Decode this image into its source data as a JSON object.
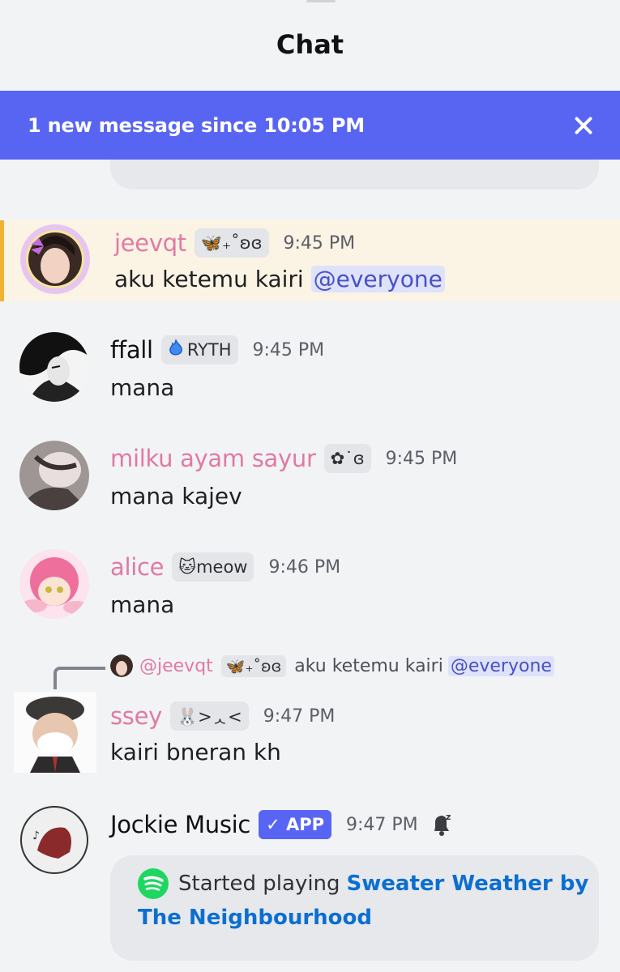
{
  "header": {
    "title": "Chat"
  },
  "banner": {
    "text": "1 new message since 10:05 PM"
  },
  "colors": {
    "accent": "#5865f2",
    "highlight_bar": "#f0b232",
    "highlight_bg": "#fbf3e4",
    "username_pink": "#e07aa4",
    "link": "#0b6fcf"
  },
  "messages": [
    {
      "username": "jeevqt",
      "tag": "🦋₊˚ʚɞ",
      "time": "9:45 PM",
      "text": "aku ketemu kairi ",
      "mention": "@everyone"
    },
    {
      "username": "ffall",
      "tag_icon": "flame-icon",
      "tag": "RYTH",
      "time": "9:45 PM",
      "text": "mana"
    },
    {
      "username": "milku ayam sayur",
      "tag": "✿˙ɞ",
      "time": "9:45 PM",
      "text": "mana kajev"
    },
    {
      "username": "alice",
      "tag": "🐱meow",
      "time": "9:46 PM",
      "text": "mana"
    },
    {
      "username": "ssey",
      "tag": "🐰>ᆺ<",
      "time": "9:47 PM",
      "text": "kairi bneran kh"
    },
    {
      "username": "Jockie Music",
      "tag": "✓ APP",
      "time": "9:47 PM",
      "bell_icon": "bell-snooze-icon"
    }
  ],
  "reply": {
    "name": "@jeevqt",
    "tag": "🦋₊˚ʚɞ",
    "text": "aku ketemu kairi",
    "mention": "@everyone"
  },
  "embed": {
    "prefix": "Started playing",
    "link_part1": "Sweater Weather by",
    "link_part2": "The Neighbourhood",
    "icon": "spotify-icon"
  }
}
